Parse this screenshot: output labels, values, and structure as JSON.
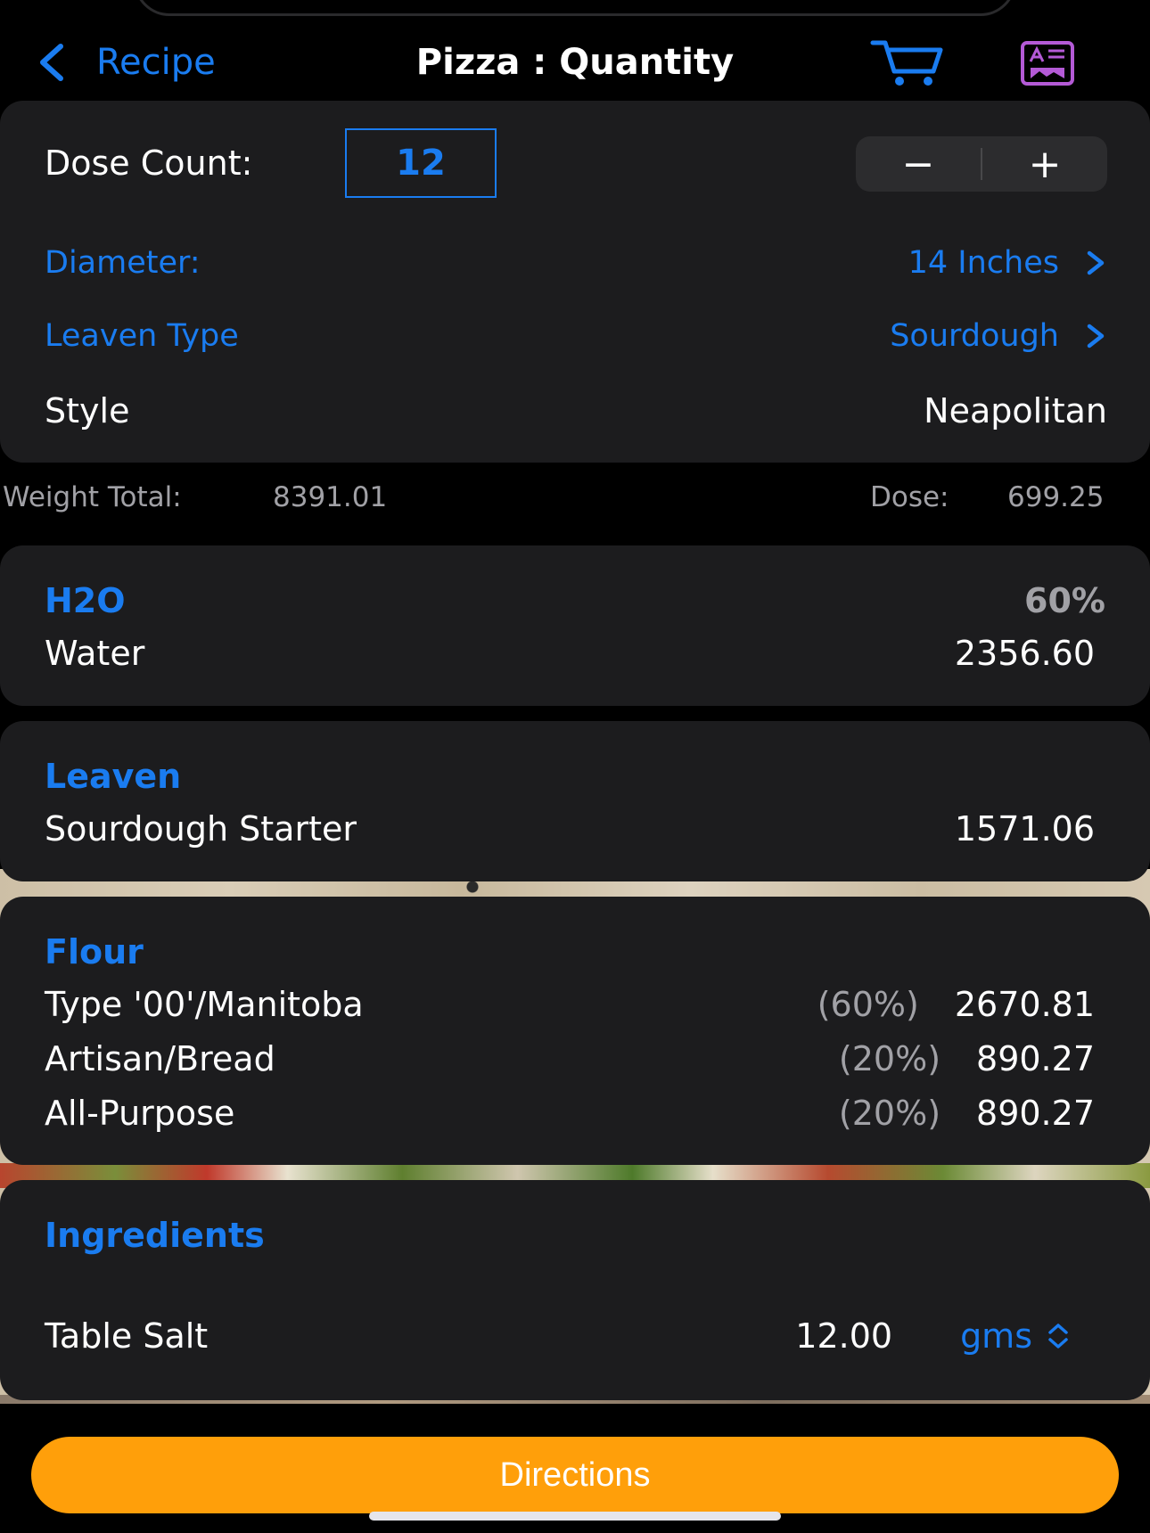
{
  "nav": {
    "back_label": "Recipe",
    "title": "Pizza : Quantity",
    "cart_icon": "cart-icon",
    "doc_icon": "document-image-icon"
  },
  "settings": {
    "dose_label": "Dose Count:",
    "dose_value": "12",
    "minus": "−",
    "plus": "+",
    "diameter_label": "Diameter:",
    "diameter_value": "14 Inches",
    "leaven_type_label": "Leaven Type",
    "leaven_type_value": "Sourdough",
    "style_label": "Style",
    "style_value": "Neapolitan"
  },
  "totals": {
    "weight_label": "Weight Total:",
    "weight_value": "8391.01",
    "dose_label": "Dose:",
    "dose_value": "699.25"
  },
  "h2o": {
    "title": "H2O",
    "percent": "60%",
    "item_name": "Water",
    "item_value": "2356.60"
  },
  "leaven": {
    "title": "Leaven",
    "item_name": "Sourdough Starter",
    "item_value": "1571.06"
  },
  "flour": {
    "title": "Flour",
    "items": [
      {
        "name": "Type '00'/Manitoba",
        "pct": "(60%)",
        "value": "2670.81"
      },
      {
        "name": "Artisan/Bread",
        "pct": "(20%)",
        "value": "890.27"
      },
      {
        "name": "All-Purpose",
        "pct": "(20%)",
        "value": "890.27"
      }
    ]
  },
  "ingredients": {
    "title": "Ingredients",
    "item_name": "Table Salt",
    "item_value": "12.00",
    "unit": "gms"
  },
  "directions_label": "Directions",
  "colors": {
    "accent": "#1a7cf0",
    "card": "#1c1c1e",
    "directions": "#ff9f0a",
    "doc_icon": "#b45ad6"
  }
}
